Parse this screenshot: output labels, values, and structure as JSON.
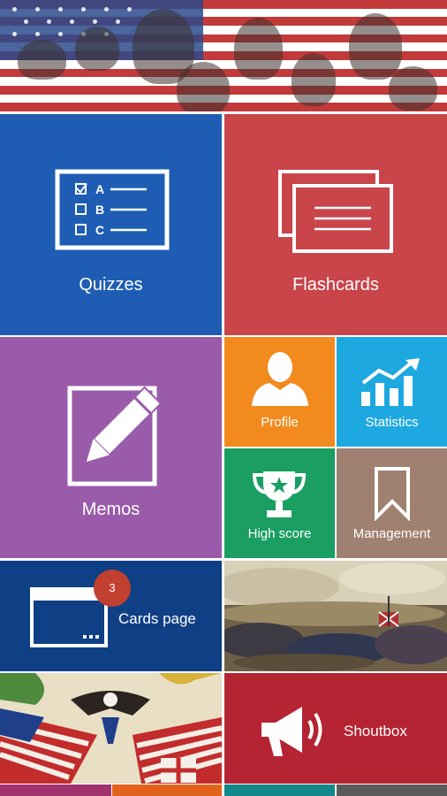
{
  "tiles": {
    "quizzes": {
      "label": "Quizzes",
      "icon": "quiz-checklist-icon",
      "color": "#1e5db3",
      "options": [
        "A",
        "B",
        "C"
      ]
    },
    "flashcards": {
      "label": "Flashcards",
      "icon": "flashcards-icon",
      "color": "#c9454a"
    },
    "memos": {
      "label": "Memos",
      "icon": "pencil-note-icon",
      "color": "#9a5bab"
    },
    "profile": {
      "label": "Profile",
      "icon": "user-silhouette-icon",
      "color": "#f28a1d"
    },
    "statistics": {
      "label": "Statistics",
      "icon": "bar-chart-icon",
      "color": "#1ea8e0"
    },
    "high_score": {
      "label": "High score",
      "icon": "trophy-icon",
      "color": "#1a9e62"
    },
    "management": {
      "label": "Management",
      "icon": "bookmark-icon",
      "color": "#a08070"
    },
    "cards_page": {
      "label": "Cards page",
      "badge": "3",
      "icon": "window-card-icon",
      "color": "#0f3f84"
    },
    "shoutbox": {
      "label": "Shoutbox",
      "icon": "megaphone-icon",
      "color": "#b52432"
    }
  },
  "images": {
    "banner": "american-history-collage-image",
    "battle": "civil-war-battle-painting-image",
    "poster": "eagle-flags-poster-image"
  }
}
